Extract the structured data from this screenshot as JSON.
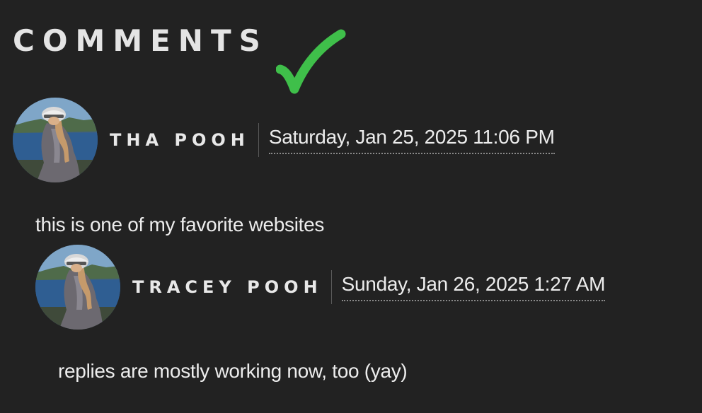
{
  "section": {
    "title": "COMMENTS"
  },
  "check_icon": {
    "icon": "check-mark-icon",
    "color": "#3fbf4a"
  },
  "comments": [
    {
      "author": "THA POOH",
      "timestamp": "Saturday, Jan 25, 2025 11:06 PM",
      "body": "this is one of my favorite websites",
      "avatar_icon": "user-avatar"
    },
    {
      "author": "TRACEY POOH",
      "timestamp": "Sunday, Jan 26, 2025 1:27 AM",
      "body": "replies are mostly working now, too (yay)",
      "avatar_icon": "user-avatar",
      "is_reply": true
    }
  ]
}
